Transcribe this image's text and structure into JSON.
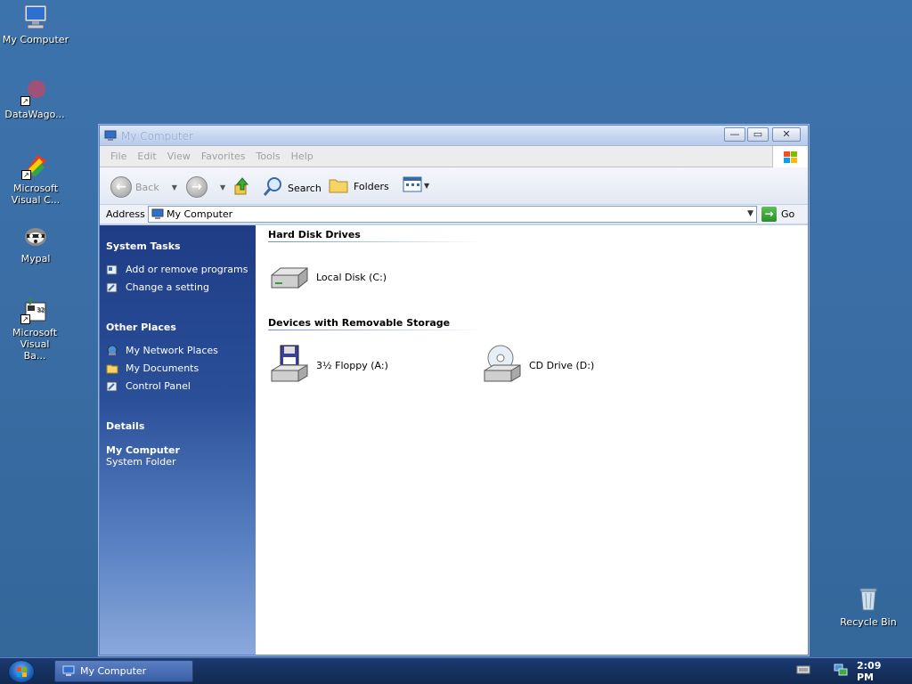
{
  "desktop": {
    "icons": [
      {
        "label": "My Computer",
        "icon": "computer-icon"
      },
      {
        "label": "DataWago...",
        "icon": "datawago-icon"
      },
      {
        "label": "Microsoft Visual C...",
        "icon": "visual-c-icon"
      },
      {
        "label": "Mypal",
        "icon": "mypal-icon"
      },
      {
        "label": "Microsoft Visual Ba...",
        "icon": "visual-basic-icon"
      },
      {
        "label": "Recycle Bin",
        "icon": "recycle-bin-icon"
      }
    ]
  },
  "window": {
    "title": "My Computer",
    "controls": {
      "minimize": "—",
      "maximize": "▭",
      "close": "✕"
    },
    "menu": [
      "File",
      "Edit",
      "View",
      "Favorites",
      "Tools",
      "Help"
    ],
    "toolbar": {
      "back": "Back",
      "search": "Search",
      "folders": "Folders"
    },
    "address": {
      "label": "Address",
      "value": "My Computer",
      "go": "Go"
    },
    "sidepane": {
      "system_tasks": {
        "title": "System Tasks",
        "links": [
          "Add or remove programs",
          "Change a setting"
        ]
      },
      "other_places": {
        "title": "Other Places",
        "links": [
          "My Network Places",
          "My Documents",
          "Control Panel"
        ]
      },
      "details": {
        "title": "Details",
        "name": "My Computer",
        "type": "System Folder"
      }
    },
    "content": {
      "groups": [
        {
          "title": "Hard Disk Drives",
          "items": [
            "Local Disk (C:)"
          ]
        },
        {
          "title": "Devices with Removable Storage",
          "items": [
            "3½ Floppy (A:)",
            "CD Drive (D:)"
          ]
        }
      ]
    }
  },
  "taskbar": {
    "task": "My Computer",
    "clock": "2:09 PM"
  }
}
